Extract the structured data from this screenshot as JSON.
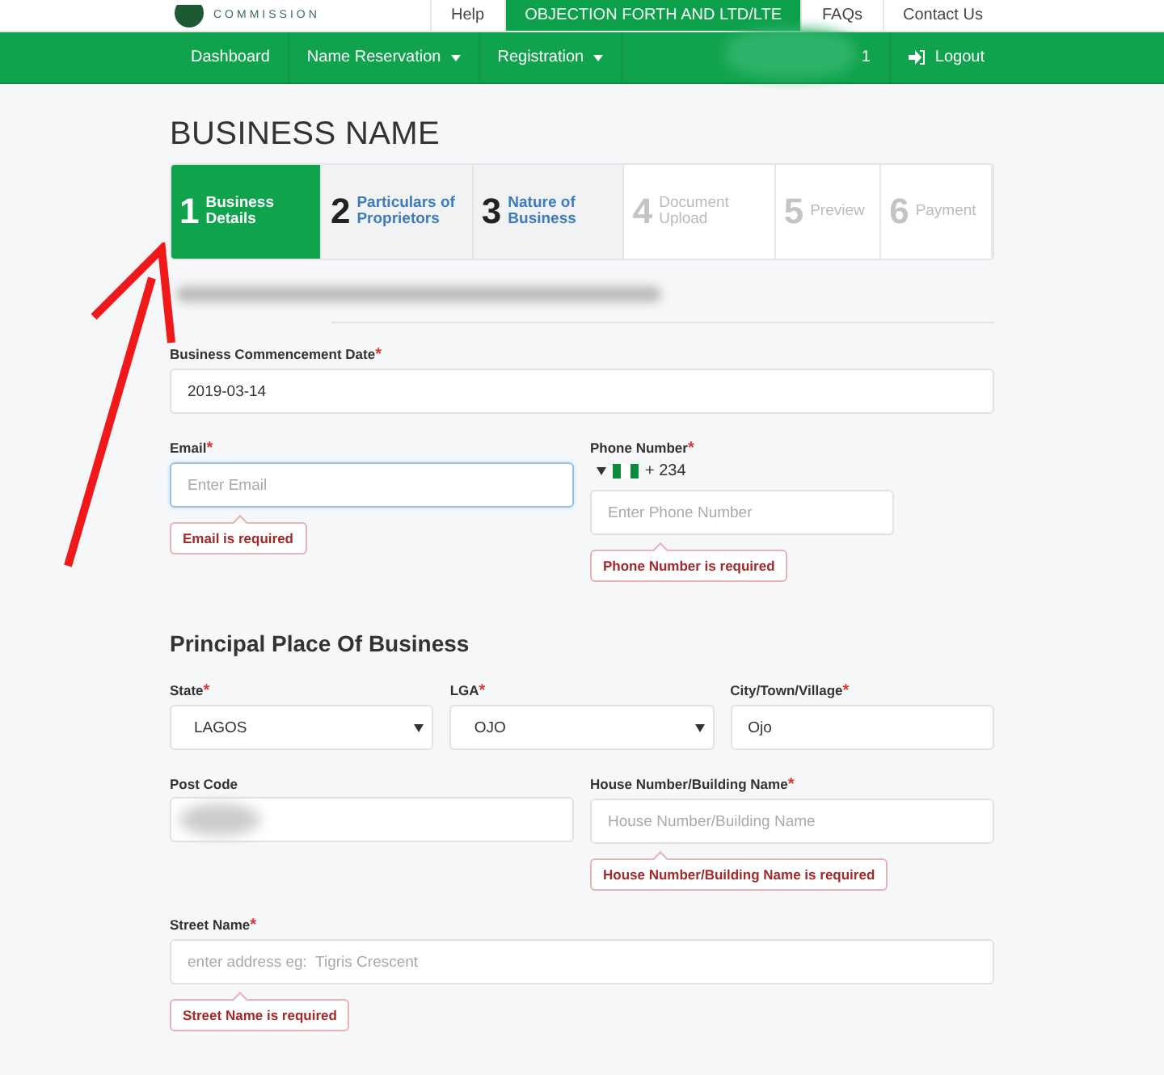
{
  "header": {
    "logo_text": "COMMISSION",
    "links": [
      {
        "label": "Help",
        "selected": false
      },
      {
        "label": "OBJECTION FORTH AND LTD/LTE",
        "selected": true
      },
      {
        "label": "FAQs",
        "selected": false
      },
      {
        "label": "Contact Us",
        "selected": false
      }
    ]
  },
  "nav": {
    "items": [
      {
        "label": "Dashboard",
        "dropdown": false
      },
      {
        "label": "Name Reservation",
        "dropdown": true
      },
      {
        "label": "Registration",
        "dropdown": true
      }
    ],
    "user": "1",
    "logout": "Logout"
  },
  "page_title": "BUSINESS NAME",
  "steps": [
    {
      "number": "1",
      "label": "Business Details",
      "selected": true,
      "disabled": false
    },
    {
      "number": "2",
      "label": "Particulars of Proprietors",
      "selected": false,
      "disabled": false
    },
    {
      "number": "3",
      "label": "Nature of Business",
      "selected": false,
      "disabled": false
    },
    {
      "number": "4",
      "label": "Document Upload",
      "selected": false,
      "disabled": true
    },
    {
      "number": "5",
      "label": "Preview",
      "selected": false,
      "disabled": true
    },
    {
      "number": "6",
      "label": "Payment",
      "selected": false,
      "disabled": true
    }
  ],
  "sections": [
    {
      "rows": [
        {
          "fields": [
            {
              "kind": "input",
              "label": "Business Commencement Date",
              "required_mark": "*",
              "value": "2019-03-14"
            }
          ]
        },
        {
          "fields": [
            {
              "kind": "input",
              "label": "Email",
              "required_mark": "*",
              "placeholder": "Enter Email",
              "focused": true,
              "error": "Email is required"
            },
            {
              "kind": "phone",
              "label": "Phone Number",
              "required_mark": "*",
              "country_code": "+ 234",
              "placeholder": "Enter Phone Number",
              "error": "Phone Number is required"
            }
          ]
        }
      ]
    },
    {
      "title": "Principal Place Of Business",
      "rows": [
        {
          "fields": [
            {
              "kind": "select",
              "label": "State",
              "required_mark": "*",
              "value": "LAGOS"
            },
            {
              "kind": "select",
              "label": "LGA",
              "required_mark": "*",
              "value": "OJO"
            },
            {
              "kind": "input",
              "label": "City/Town/Village",
              "required_mark": "*",
              "value": "Ojo"
            }
          ]
        },
        {
          "fields": [
            {
              "kind": "input",
              "label": "Post Code",
              "redacted": true
            },
            {
              "kind": "input",
              "label": "House Number/Building Name",
              "required_mark": "*",
              "placeholder": "House Number/Building Name",
              "error": "House Number/Building Name is required"
            }
          ]
        },
        {
          "fields": [
            {
              "kind": "input",
              "label": "Street Name",
              "required_mark": "*",
              "placeholder": "enter address eg:  Tigris Crescent",
              "error": "Street Name is required"
            }
          ]
        }
      ]
    }
  ]
}
